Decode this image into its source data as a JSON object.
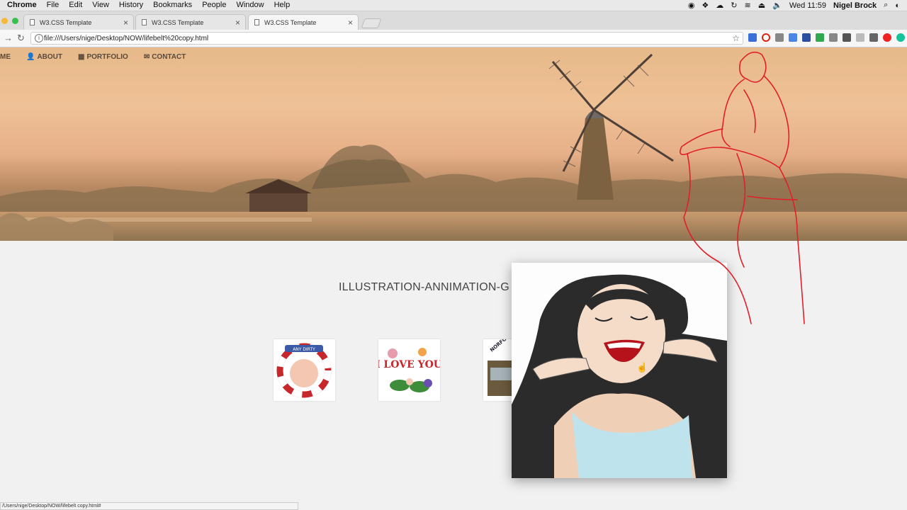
{
  "menubar": {
    "app": "Chrome",
    "items": [
      "File",
      "Edit",
      "View",
      "History",
      "Bookmarks",
      "People",
      "Window",
      "Help"
    ],
    "clock": "Wed 11:59",
    "user": "Nigel Brock"
  },
  "tabs": [
    {
      "title": "W3.CSS Template"
    },
    {
      "title": "W3.CSS Template"
    },
    {
      "title": "W3.CSS Template"
    }
  ],
  "address": {
    "url": "file:///Users/nige/Desktop/NOW/lifebelt%20copy.html"
  },
  "nav": {
    "home": "ME",
    "about": "ABOUT",
    "portfolio": "PORTFOLIO",
    "contact": "CONTACT"
  },
  "section": {
    "title": "ILLUSTRATION-ANNIMATION-G"
  },
  "thumbs": [
    {
      "label": "ANY DIRTY"
    },
    {
      "label": "I LOVE YOU"
    },
    {
      "label": "NORFOL"
    }
  ],
  "status": {
    "text": "/Users/nige/Desktop/NOW/lifebelt copy.html#"
  },
  "colors": {
    "accent_red": "#e0202a",
    "hero_sky": "#efc196",
    "page_bg": "#f1f1f1"
  }
}
